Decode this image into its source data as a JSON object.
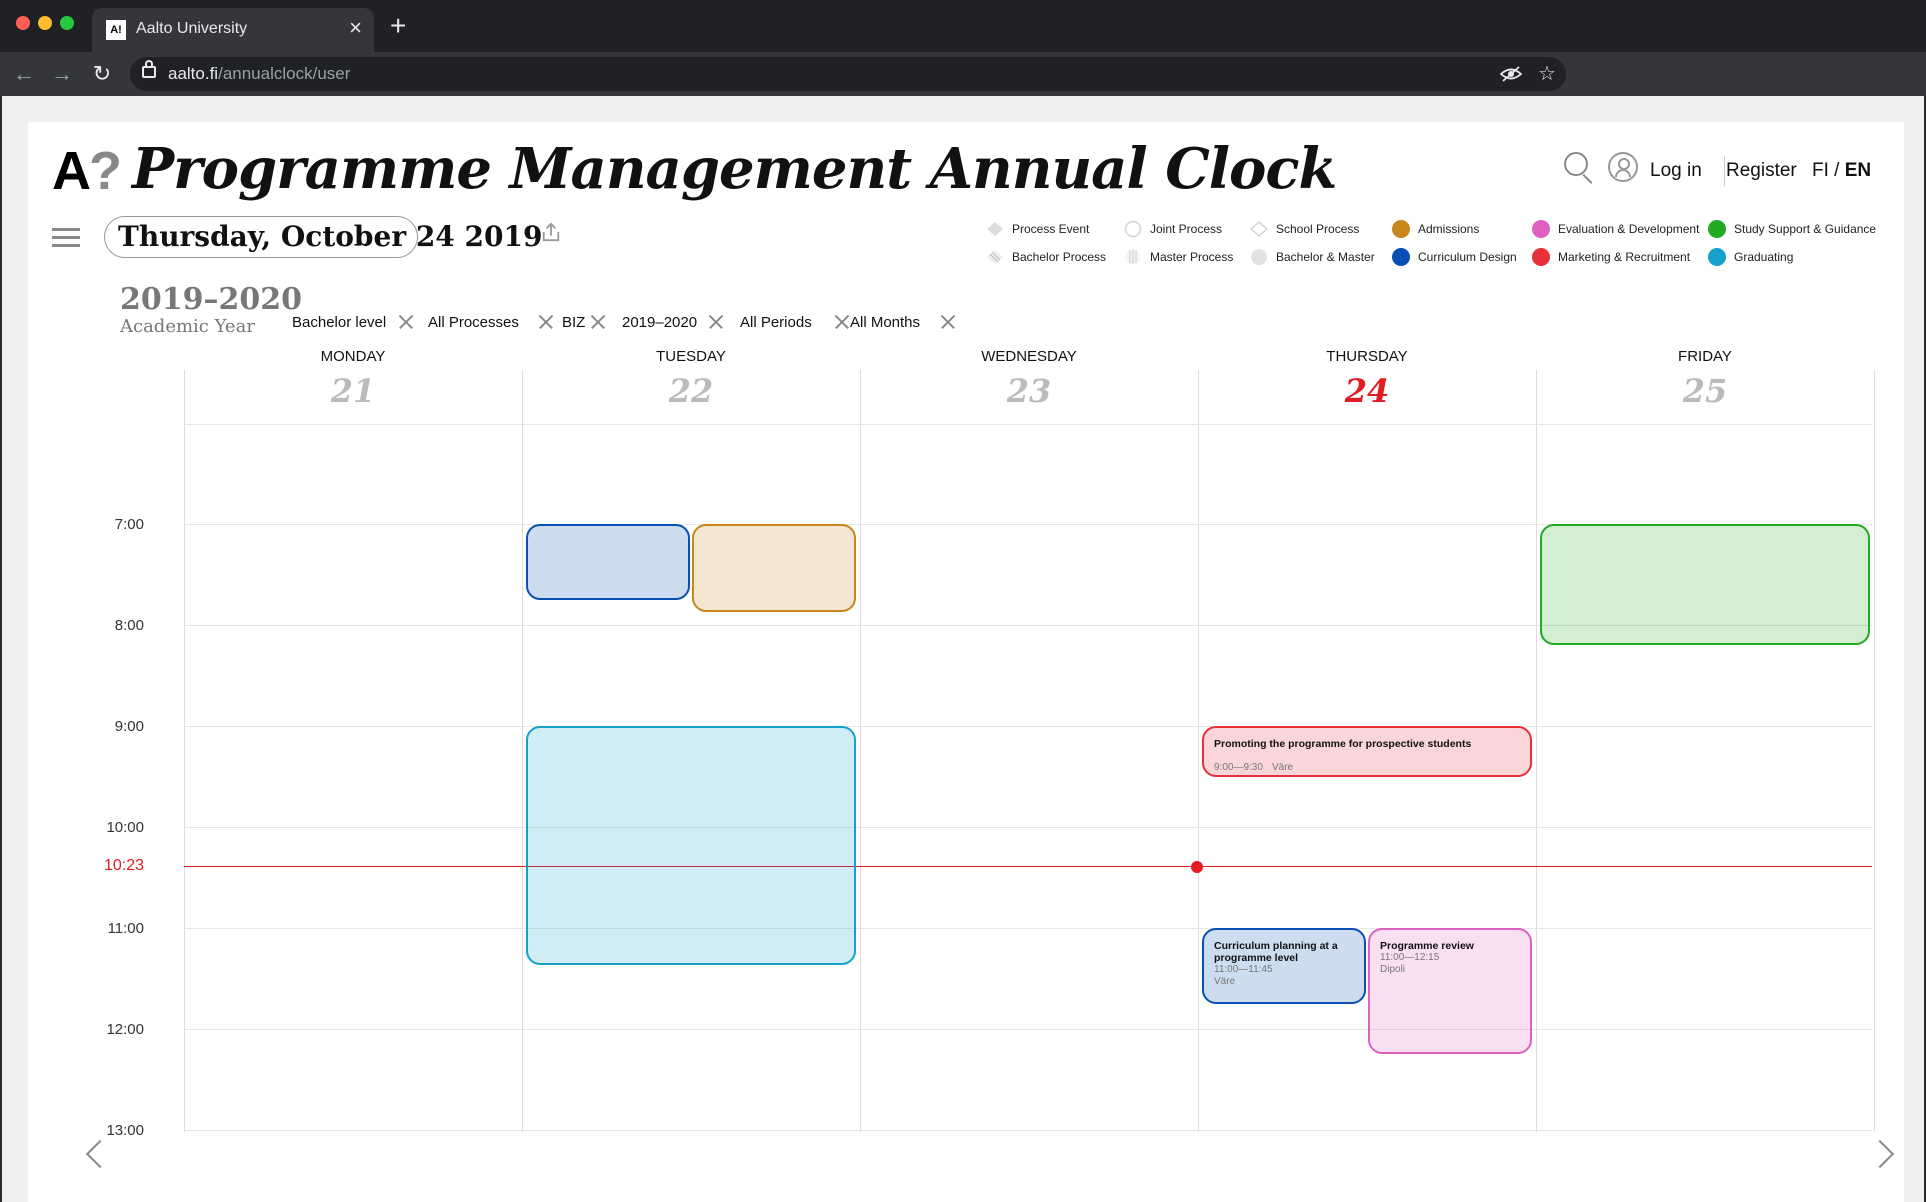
{
  "browser": {
    "tab_title": "Aalto University",
    "favicon": "A!",
    "url_host": "aalto.fi",
    "url_path": "/annualclock/user"
  },
  "header": {
    "logo_a": "A",
    "logo_q": "?",
    "title": "Programme Management Annual Clock",
    "login": "Log in",
    "register": "Register",
    "lang_fi": "FI",
    "lang_sep": " / ",
    "lang_en": "EN"
  },
  "date_display": "Thursday, October 24 2019",
  "legend": [
    {
      "label": "Process Event",
      "icon": "diamond-filled"
    },
    {
      "label": "Joint Process",
      "icon": "circle-outline"
    },
    {
      "label": "School Process",
      "icon": "diamond-outline"
    },
    {
      "label": "Admissions",
      "color": "#c8871a"
    },
    {
      "label": "Evaluation & Development",
      "color": "#e060c0"
    },
    {
      "label": "Study Support & Guidance",
      "color": "#22aa22"
    },
    {
      "label": "Bachelor Process",
      "icon": "diamond-hatched"
    },
    {
      "label": "Master Process",
      "icon": "circle-striped"
    },
    {
      "label": "Bachelor & Master",
      "icon": "circle-grey"
    },
    {
      "label": "Curriculum Design",
      "color": "#0a4fb4"
    },
    {
      "label": "Marketing & Recruitment",
      "color": "#e8303a"
    },
    {
      "label": "Graduating",
      "color": "#16a2c8"
    }
  ],
  "academic_year": {
    "year": "2019–2020",
    "label": "Academic Year"
  },
  "filters": [
    "Bachelor level",
    "All Processes",
    "BIZ",
    "2019–2020",
    "All Periods",
    "All Months"
  ],
  "days": [
    {
      "name": "MONDAY",
      "num": "21",
      "today": false
    },
    {
      "name": "TUESDAY",
      "num": "22",
      "today": false
    },
    {
      "name": "WEDNESDAY",
      "num": "23",
      "today": false
    },
    {
      "name": "THURSDAY",
      "num": "24",
      "today": true
    },
    {
      "name": "FRIDAY",
      "num": "25",
      "today": false
    }
  ],
  "times": [
    "7:00",
    "8:00",
    "9:00",
    "10:00",
    "11:00",
    "12:00",
    "13:00"
  ],
  "now": "10:23",
  "events": [
    {
      "day": 1,
      "start": "7:00",
      "end": "7:45",
      "slot": 0,
      "category": "Curriculum Design",
      "title": "",
      "time": "",
      "place": ""
    },
    {
      "day": 1,
      "start": "7:00",
      "end": "7:52",
      "slot": 1,
      "category": "Admissions",
      "title": "",
      "time": "",
      "place": ""
    },
    {
      "day": 1,
      "start": "9:00",
      "end": "11:22",
      "slot": 2,
      "category": "Graduating",
      "title": "",
      "time": "",
      "place": ""
    },
    {
      "day": 4,
      "start": "7:00",
      "end": "8:12",
      "slot": 2,
      "category": "Study Support & Guidance",
      "title": "",
      "time": "",
      "place": ""
    },
    {
      "day": 3,
      "start": "9:00",
      "end": "9:30",
      "slot": 2,
      "category": "Marketing & Recruitment",
      "title": "Promoting the programme for prospective students",
      "time": "9:00—9:30",
      "place": "Väre"
    },
    {
      "day": 3,
      "start": "11:00",
      "end": "11:45",
      "slot": 0,
      "category": "Curriculum Design",
      "title": "Curriculum planning at a programme level",
      "time": "11:00—11:45",
      "place": "Väre"
    },
    {
      "day": 3,
      "start": "11:00",
      "end": "12:15",
      "slot": 1,
      "category": "Evaluation & Development",
      "title": "Programme review",
      "time": "11:00—12:15",
      "place": "Dipoli"
    }
  ]
}
